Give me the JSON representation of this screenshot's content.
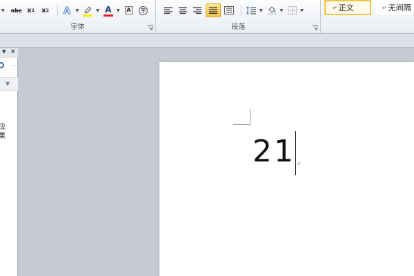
{
  "ribbon": {
    "font_group": {
      "label": "字体",
      "buttons": {
        "strikethrough": "abc",
        "subscript_base": "x",
        "subscript_mark": "2",
        "superscript_base": "x",
        "superscript_mark": "2",
        "font_color": "A",
        "char_shading": "A",
        "enclose_char": "字"
      },
      "highlight_color": "#ffee00",
      "font_color_value": "#e02020"
    },
    "paragraph_group": {
      "label": "段落"
    },
    "styles_group": {
      "normal": "正文",
      "no_spacing": "无间隔"
    },
    "accent_color": "#f8c24b"
  },
  "navigation_pane": {
    "text_line1": "应",
    "text_line2": "果"
  },
  "document": {
    "body_text": "21"
  }
}
